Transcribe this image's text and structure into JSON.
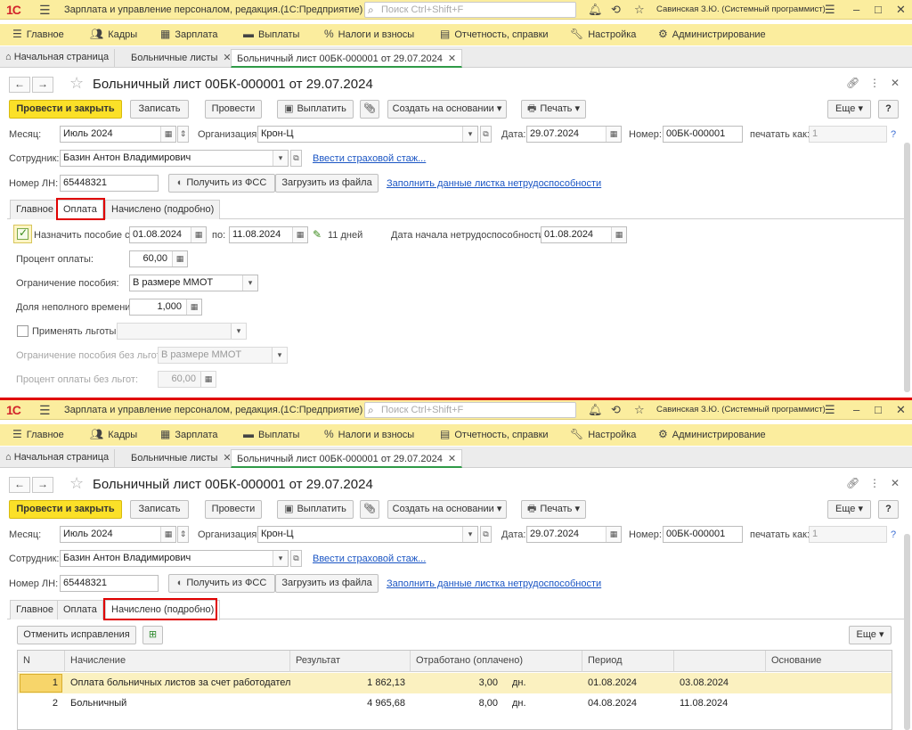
{
  "window": {
    "logo": "1С",
    "title": "Зарплата и управление персоналом, редакция...",
    "mode": "(1С:Предприятие)",
    "search_placeholder": "Поиск Ctrl+Shift+F",
    "user": "Савинская З.Ю. (Системный программист)"
  },
  "menu": [
    {
      "label": "Главное",
      "icon": "hamburger-icon"
    },
    {
      "label": "Кадры",
      "icon": "people-icon"
    },
    {
      "label": "Зарплата",
      "icon": "calculator-icon"
    },
    {
      "label": "Выплаты",
      "icon": "wallet-icon"
    },
    {
      "label": "Налоги и взносы",
      "icon": "percent-icon"
    },
    {
      "label": "Отчетность, справки",
      "icon": "report-icon"
    },
    {
      "label": "Настройка",
      "icon": "wrench-icon"
    },
    {
      "label": "Администрирование",
      "icon": "gear-icon"
    }
  ],
  "doc_tabs": {
    "home": "Начальная страница",
    "list": "Больничные листы",
    "doc": "Больничный лист 00БК-000001 от 29.07.2024"
  },
  "form": {
    "title": "Больничный лист 00БК-000001 от 29.07.2024",
    "buttons": {
      "post_close": "Провести и закрыть",
      "save": "Записать",
      "post": "Провести",
      "pay": "Выплатить",
      "create_based": "Создать на основании",
      "print": "Печать",
      "more": "Еще",
      "help": "?"
    },
    "month_label": "Месяц:",
    "month": "Июль 2024",
    "org_label": "Организация:",
    "org": "Крон-Ц",
    "date_label": "Дата:",
    "date": "29.07.2024",
    "number_label": "Номер:",
    "number": "00БК-000001",
    "print_as_label": "печатать как:",
    "print_as": "1",
    "print_as_help": "?",
    "employee_label": "Сотрудник:",
    "employee": "Базин Антон Владимирович",
    "insurance_link": "Ввести страховой стаж...",
    "ln_label": "Номер ЛН:",
    "ln": "65448321",
    "get_fss": "Получить из ФСС",
    "load_file": "Загрузить из файла",
    "fill_link": "Заполнить данные листка нетрудоспособности"
  },
  "inner_tabs": {
    "main": "Главное",
    "payment": "Оплата",
    "accrued": "Начислено (подробно)"
  },
  "payment": {
    "assign_label": "Назначить пособие с:",
    "assign_checked": true,
    "from": "01.08.2024",
    "to_label": "по:",
    "to": "11.08.2024",
    "days": "11 дней",
    "start_label": "Дата начала нетрудоспособности:",
    "start": "01.08.2024",
    "percent_label": "Процент оплаты:",
    "percent": "60,00",
    "limit_label": "Ограничение пособия:",
    "limit": "В размере ММОТ",
    "parttime_label": "Доля неполного времени:",
    "parttime": "1,000",
    "benefits_label": "Применять льготы",
    "benefits_checked": false,
    "limit_nobenefit_label": "Ограничение пособия без льгот:",
    "limit_nobenefit": "В размере ММОТ",
    "percent_nobenefit_label": "Процент оплаты без льгот:",
    "percent_nobenefit": "60,00"
  },
  "accrued": {
    "cancel_fix": "Отменить исправления",
    "more": "Еще",
    "columns": [
      "N",
      "Начисление",
      "Результат",
      "Отработано (оплачено)",
      "Период",
      "",
      "Основание"
    ],
    "rows": [
      {
        "n": "1",
        "name": "Оплата больничных листов за счет работодателя",
        "result": "1 862,13",
        "worked": "3,00",
        "unit": "дн.",
        "from": "01.08.2024",
        "to": "03.08.2024",
        "basis": ""
      },
      {
        "n": "2",
        "name": "Больничный",
        "result": "4 965,68",
        "worked": "8,00",
        "unit": "дн.",
        "from": "04.08.2024",
        "to": "11.08.2024",
        "basis": ""
      }
    ]
  },
  "colors": {
    "chrome_yellow": "#fbed9e",
    "primary_button": "#fbe028",
    "highlight_red": "#e00000",
    "link": "#1a55c4",
    "selected_row": "#fbf1c0"
  }
}
